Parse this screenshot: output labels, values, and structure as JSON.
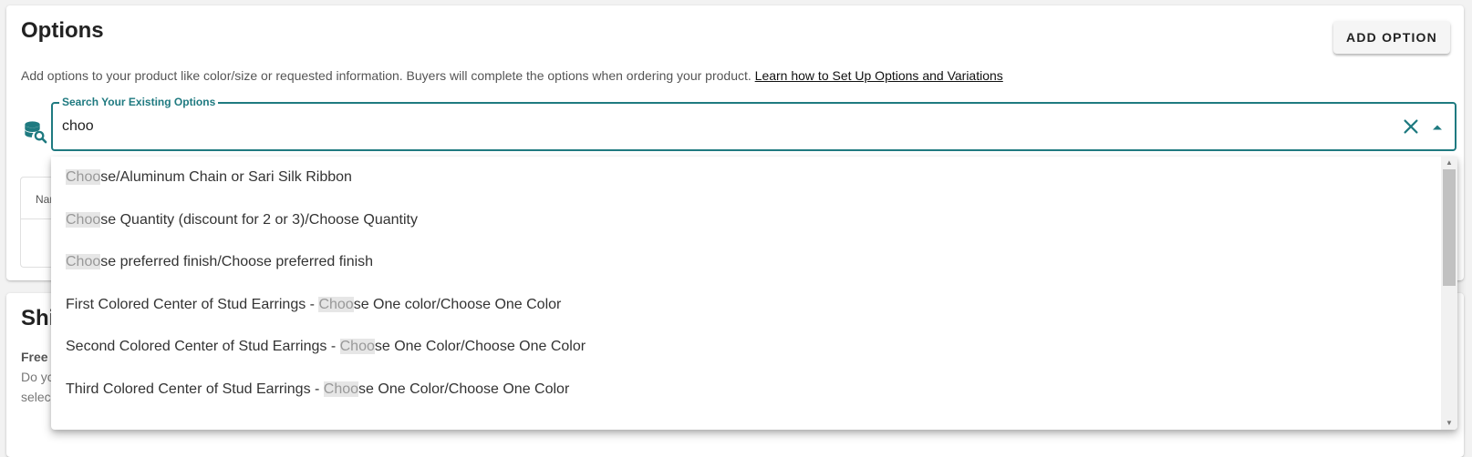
{
  "options_card": {
    "title": "Options",
    "add_button": "ADD OPTION",
    "description": "Add options to your product like color/size or requested information. Buyers will complete the options when ordering your product.",
    "learn_link": "Learn how to Set Up Options and Variations",
    "search": {
      "label": "Search Your Existing Options",
      "value": "choo"
    },
    "table_header_stub": "Nar"
  },
  "shipping_card": {
    "title": "Shi",
    "line1": "Free",
    "line2": "Do yc",
    "line3": "selec"
  },
  "dropdown": {
    "items": [
      {
        "pre": "",
        "match": "Choo",
        "post": "se/Aluminum Chain or Sari Silk Ribbon"
      },
      {
        "pre": "",
        "match": "Choo",
        "post": "se Quantity (discount for 2 or 3)/Choose Quantity"
      },
      {
        "pre": "",
        "match": "Choo",
        "post": "se preferred finish/Choose preferred finish"
      },
      {
        "pre": "First Colored Center of Stud Earrings - ",
        "match": "Choo",
        "post": "se One color/Choose One Color"
      },
      {
        "pre": "Second Colored Center of Stud Earrings - ",
        "match": "Choo",
        "post": "se One Color/Choose One Color"
      },
      {
        "pre": "Third Colored Center of Stud Earrings - ",
        "match": "Choo",
        "post": "se One Color/Choose One Color"
      }
    ]
  },
  "icons": {
    "database": "database-search-icon",
    "clear": "close-icon",
    "caret": "caret-up-icon"
  },
  "colors": {
    "accent": "#1f7a80",
    "highlight_bg": "#e6e6e6"
  }
}
